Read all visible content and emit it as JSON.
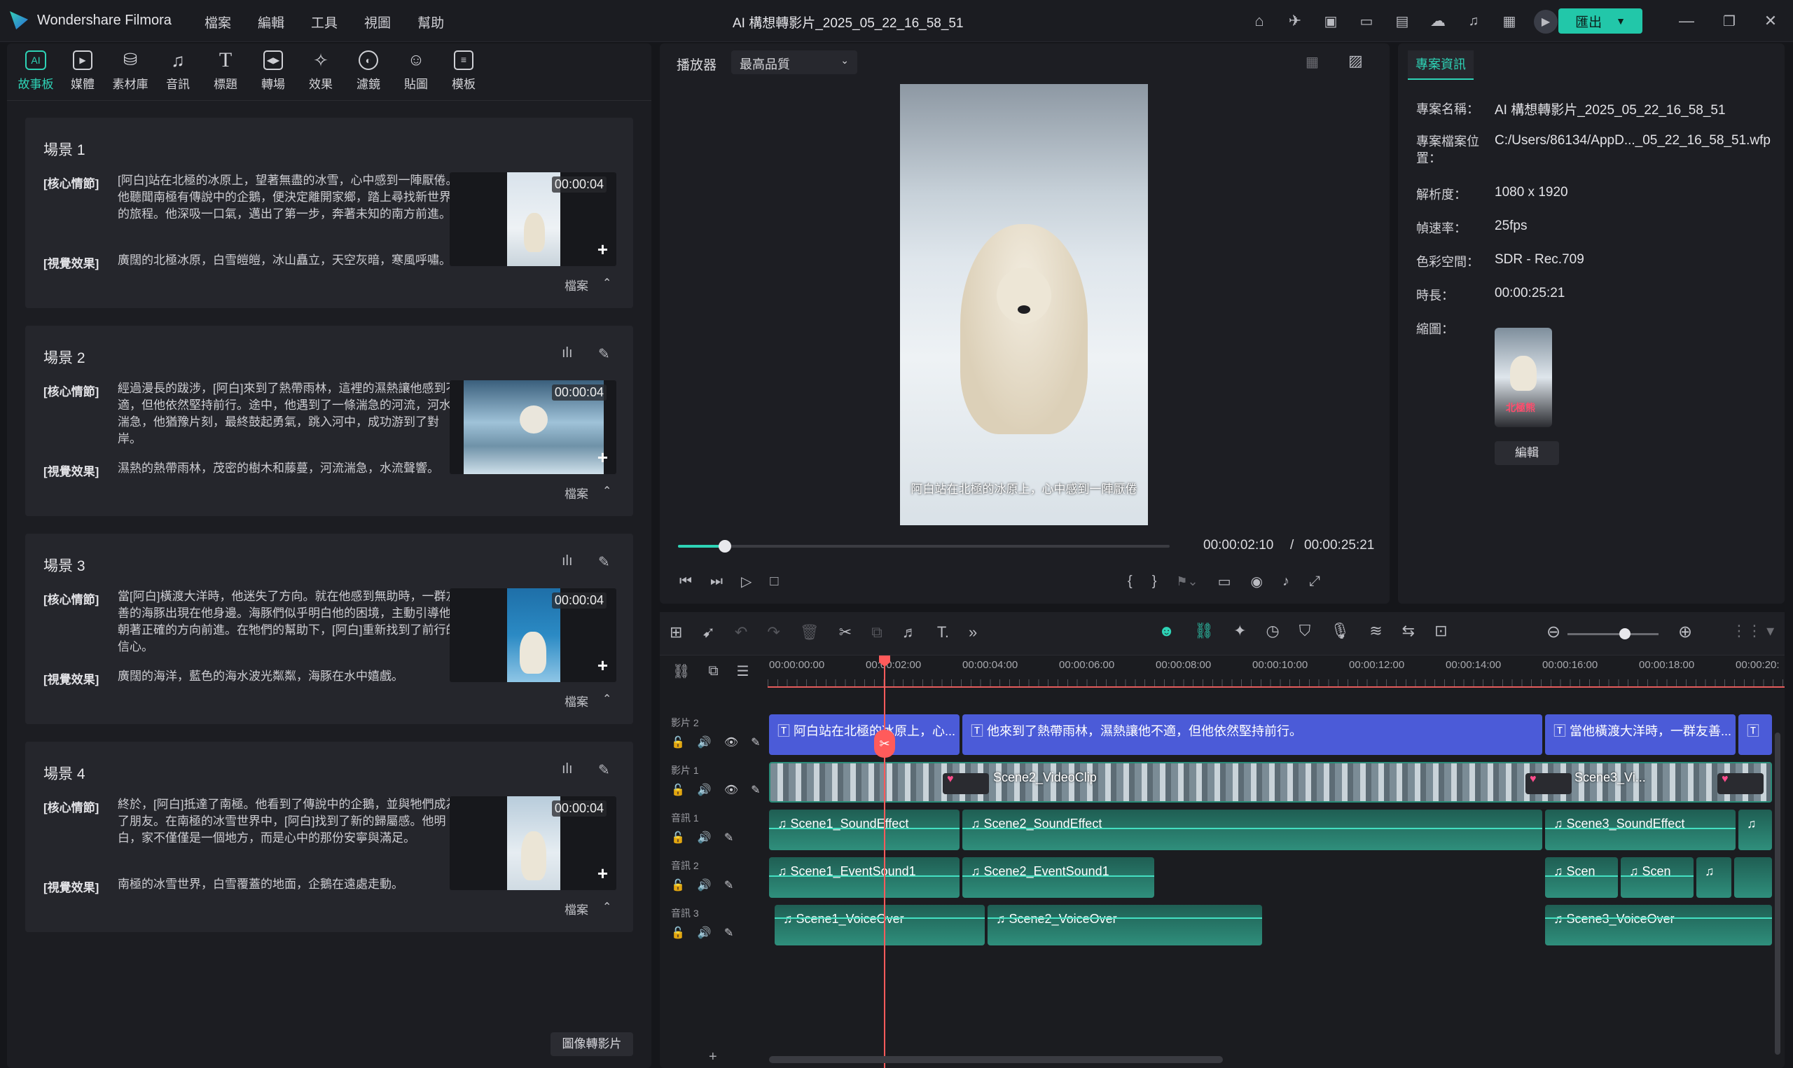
{
  "app": {
    "name": "Wondershare Filmora",
    "title": "AI 構想轉影片_2025_05_22_16_58_51",
    "export_label": "匯出"
  },
  "menu": [
    "檔案",
    "編輯",
    "工具",
    "視圖",
    "幫助"
  ],
  "toolbar": [
    {
      "label": "故事板",
      "icon": "storyboard-icon",
      "active": true
    },
    {
      "label": "媒體",
      "icon": "media-icon"
    },
    {
      "label": "素材庫",
      "icon": "library-icon"
    },
    {
      "label": "音訊",
      "icon": "music-note-icon"
    },
    {
      "label": "標題",
      "icon": "title-t-icon"
    },
    {
      "label": "轉場",
      "icon": "transition-icon"
    },
    {
      "label": "效果",
      "icon": "effect-icon"
    },
    {
      "label": "濾鏡",
      "icon": "filter-icon"
    },
    {
      "label": "貼圖",
      "icon": "sticker-icon"
    },
    {
      "label": "模板",
      "icon": "template-icon"
    }
  ],
  "scenes": [
    {
      "title": "場景 1",
      "core_label": "[核心情節]",
      "core": "[阿白]站在北極的冰原上，望著無盡的冰雪，心中感到一陣厭倦。他聽聞南極有傳說中的企鵝，便決定離開家鄉，踏上尋找新世界的旅程。他深吸一口氣，邁出了第一步，奔著未知的南方前進。",
      "visual_label": "[視覺效果]",
      "visual": "廣闊的北極冰原，白雪皚皚，冰山矗立，天空灰暗，寒風呼嘯。",
      "duration": "00:00:04",
      "file_label": "檔案"
    },
    {
      "title": "場景 2",
      "core_label": "[核心情節]",
      "core": "經過漫長的跋涉，[阿白]來到了熱帶雨林，這裡的濕熱讓他感到不適，但他依然堅持前行。途中，他遇到了一條湍急的河流，河水湍急，他猶豫片刻，最終鼓起勇氣，跳入河中，成功游到了對岸。",
      "visual_label": "[視覺效果]",
      "visual": "濕熱的熱帶雨林，茂密的樹木和藤蔓，河流湍急，水流聲響。",
      "duration": "00:00:04",
      "file_label": "檔案"
    },
    {
      "title": "場景 3",
      "core_label": "[核心情節]",
      "core": "當[阿白]橫渡大洋時，他迷失了方向。就在他感到無助時，一群友善的海豚出現在他身邊。海豚們似乎明白他的困境，主動引導他朝著正確的方向前進。在牠們的幫助下，[阿白]重新找到了前行的信心。",
      "visual_label": "[視覺效果]",
      "visual": "廣闊的海洋，藍色的海水波光粼粼，海豚在水中嬉戲。",
      "duration": "00:00:04",
      "file_label": "檔案"
    },
    {
      "title": "場景 4",
      "core_label": "[核心情節]",
      "core": "終於，[阿白]抵達了南極。他看到了傳說中的企鵝，並與牠們成為了朋友。在南極的冰雪世界中，[阿白]找到了新的歸屬感。他明白，家不僅僅是一個地方，而是心中的那份安寧與滿足。",
      "visual_label": "[視覺效果]",
      "visual": "南極的冰雪世界，白雪覆蓋的地面，企鵝在遠處走動。",
      "duration": "00:00:04",
      "file_label": "檔案"
    }
  ],
  "image_to_video_label": "圖像轉影片",
  "player": {
    "label": "播放器",
    "quality": "最高品質",
    "subtitle": "阿白站在北極的冰原上，心中感到一陣厭倦",
    "current": "00:00:02:10",
    "sep": "/",
    "total": "00:00:25:21",
    "progress": 0.095
  },
  "project": {
    "tab": "專案資訊",
    "rows": [
      {
        "k": "專案名稱：",
        "v": "AI 構想轉影片_2025_05_22_16_58_51"
      },
      {
        "k": "專案檔案位置：",
        "v": "C:/Users/86134/AppD..._05_22_16_58_51.wfp"
      },
      {
        "k": "解析度：",
        "v": "1080 x 1920"
      },
      {
        "k": "幀速率：",
        "v": "25fps"
      },
      {
        "k": "色彩空間：",
        "v": "SDR - Rec.709"
      },
      {
        "k": "時長：",
        "v": "00:00:25:21"
      },
      {
        "k": "縮圖：",
        "v": ""
      }
    ],
    "thumb_text": "北極熊",
    "edit_label": "編輯"
  },
  "ruler": [
    "00:00:00:00",
    "00:00:02:00",
    "00:00:04:00",
    "00:00:06:00",
    "00:00:08:00",
    "00:00:10:00",
    "00:00:12:00",
    "00:00:14:00",
    "00:00:16:00",
    "00:00:18:00",
    "00:00:20:"
  ],
  "tracks": {
    "v2": "影片 2",
    "v1": "影片 1",
    "a1": "音訊 1",
    "a2": "音訊 2",
    "a3": "音訊 3"
  },
  "clips": {
    "t1": "阿白站在北極的冰原上，心...",
    "t2": "他來到了熱帶雨林，濕熱讓他不適，但他依然堅持前行。",
    "t3": "當他橫渡大洋時，一群友善...",
    "v2": "Scene2_VideoClip",
    "v3": "Scene3_Vi...",
    "s1": "Scene1_SoundEffect",
    "s2": "Scene2_SoundEffect",
    "s3": "Scene3_SoundEffect",
    "e1": "Scene1_EventSound1",
    "e2": "Scene2_EventSound1",
    "e3": "Scen",
    "e4": "Scen",
    "o1": "Scene1_VoiceOver",
    "o2": "Scene2_VoiceOver",
    "o3": "Scene3_VoiceOver"
  },
  "colors": {
    "accent": "#22c7a9",
    "title_clip": "#4b5bd8",
    "playhead": "#ff5b5b",
    "audio": "#2f8f7c"
  }
}
